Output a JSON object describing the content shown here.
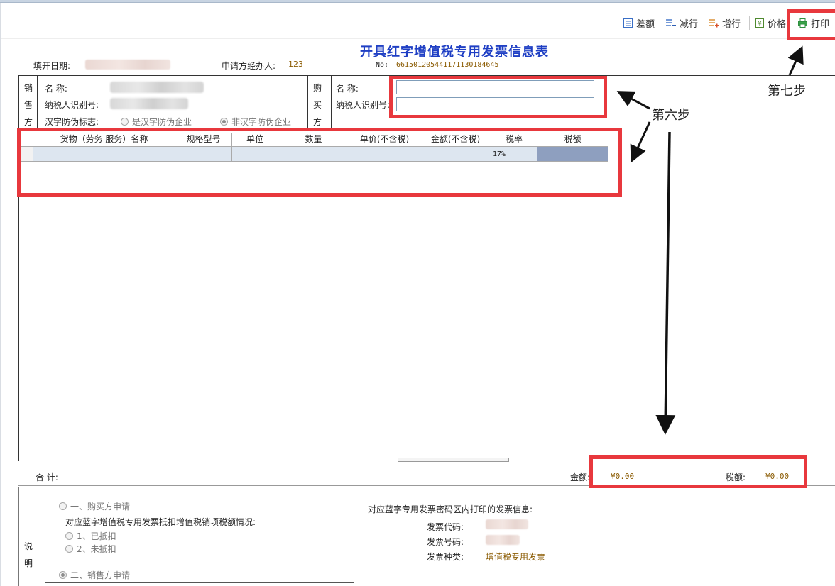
{
  "toolbar": {
    "diff_amount": "差额",
    "remove_row": "减行",
    "add_row": "增行",
    "price": "价格",
    "print": "打印"
  },
  "form": {
    "title": "开具红字增值税专用发票信息表",
    "fill_date_label": "填开日期:",
    "applicant_label": "申请方经办人:",
    "applicant_value": "123",
    "no_label": "No:",
    "no_value": "661501205441171130184645"
  },
  "seller": {
    "side_label": [
      "销",
      "售",
      "方"
    ],
    "name_label": "名        称:",
    "tax_id_label": "纳税人识别号:",
    "anti_fake_label": "汉字防伪标志:",
    "options": [
      {
        "label": "是汉字防伪企业",
        "selected": false
      },
      {
        "label": "非汉字防伪企业",
        "selected": true
      }
    ]
  },
  "buyer": {
    "side_label": [
      "购",
      "买",
      "方"
    ],
    "name_label": "名        称:",
    "tax_id_label": "纳税人识别号:",
    "name_value": "",
    "tax_id_value": ""
  },
  "grid": {
    "columns": [
      "",
      "货物（劳务 服务）名称",
      "规格型号",
      "单位",
      "数量",
      "单价(不含税)",
      "金额(不含税)",
      "税率",
      "税额"
    ],
    "rows": [
      [
        "",
        "",
        "",
        "",
        "",
        "",
        "",
        "17%",
        ""
      ]
    ]
  },
  "totals": {
    "label": "合  计:",
    "amount_label": "金额:",
    "amount_value": "¥0.00",
    "tax_label": "税额:",
    "tax_value": "¥0.00"
  },
  "notes": {
    "side_label": [
      "说",
      "明"
    ],
    "option1": "一、购买方申请",
    "option1_desc": "对应蓝字增值税专用发票抵扣增值税销项税额情况:",
    "sub1": "1、已抵扣",
    "sub2": "2、未抵扣",
    "option2": "二、销售方申请",
    "blue_info_title": "对应蓝字专用发票密码区内打印的发票信息:",
    "invoice_code_label": "发票代码:",
    "invoice_no_label": "发票号码:",
    "invoice_type_label": "发票种类:",
    "invoice_type_value": "增值税专用发票"
  },
  "annotations": {
    "step6": "第六步",
    "step7": "第七步"
  },
  "colors": {
    "title": "#1f3fc4",
    "value": "#8a5a00",
    "highlight": "#e8383d",
    "selected_cell": "#8e9fbf",
    "row_fill": "#dde6f0"
  },
  "icons": [
    "diff-icon",
    "remove-row-icon",
    "add-row-icon",
    "price-icon",
    "printer-icon"
  ]
}
